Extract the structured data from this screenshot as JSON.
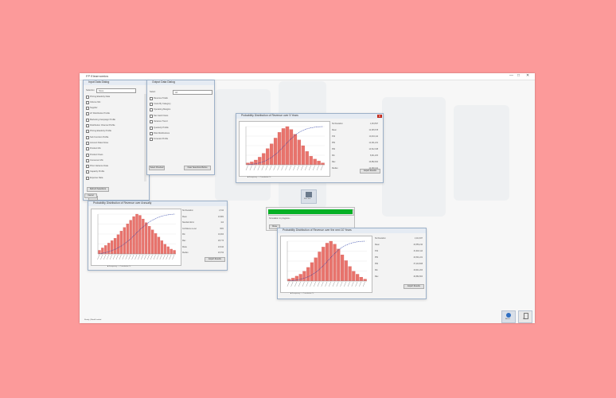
{
  "app": {
    "title": "FP Elearnomics",
    "controls": [
      "—",
      "□",
      "✕"
    ]
  },
  "left_window": {
    "title": "Input Data Dialog",
    "filter_label": "Selection",
    "filter_value": "None",
    "items": [
      "Pricing Elasticity Data",
      "Volume Mix",
      "Supplier",
      "LP Distribution Profile",
      "Marketing Campaign Profile",
      "Distribution Channel Profile",
      "Pricing Elasticity Profile",
      "Sub Function Profile",
      "Account Data Flows",
      "Product Mix",
      "Product Flows",
      "Consumer Mix",
      "Price Variance Data",
      "Capacity Profile",
      "Expense Data"
    ],
    "button_refresh": "Refresh Selections",
    "button_ok": "OK",
    "button_cancel": "Cancel"
  },
  "mid_window": {
    "title": "Output Data Dialog",
    "label": "Select",
    "select_value": "All",
    "items": [
      "Revenue Totals",
      "Costs By Category",
      "Operating Margins",
      "Net Cash Flows",
      "Variance Trend",
      "Quarterly Profile",
      "Risk Distributions",
      "Forecast Profile"
    ],
    "button_select": "Select Checked",
    "button_clear": "Clear Selections Before"
  },
  "charts": [
    {
      "name": "chart-revenue-5-years",
      "title": "Probability Distribution of Revenue over 5 Years",
      "stats_labels": [
        "Std Deviation",
        "Mean",
        "P10",
        "P50",
        "P90",
        "Min",
        "Max",
        "Median"
      ],
      "stats_values": [
        "1,234,567",
        "12,345,678",
        "10,234,112",
        "12,301,221",
        "14,512,338",
        "8,011,203",
        "16,882,904",
        "12,300,441"
      ],
      "legend": "■ Frequency   — Cumulative %",
      "button": "Export Results"
    },
    {
      "name": "chart-revenue-annual",
      "title": "Probability Distribution of Revenue over Annually",
      "stats_labels": [
        "Std Deviation",
        "Mean",
        "Standard Error",
        "Confidence Level",
        "Min",
        "Max",
        "Mode",
        "Median"
      ],
      "stats_values": [
        "2,312",
        "23,881",
        "112",
        "95%",
        "19,004",
        "28,773",
        "23,610",
        "23,702"
      ],
      "legend": "■ Frequency   — Cumulative %",
      "button": "Export Results"
    },
    {
      "name": "chart-revenue-10-years",
      "title": "Probability Distribution of Revenue over the next 10 Years",
      "stats_labels": [
        "Std Deviation",
        "Mean",
        "P10",
        "P50",
        "P90",
        "Min",
        "Max"
      ],
      "stats_values": [
        "2,114,337",
        "34,556,210",
        "31,902,114",
        "34,501,221",
        "37,204,668",
        "29,011,203",
        "40,882,904"
      ],
      "legend": "■ Frequency   — Cumulative %",
      "button": "Export Results"
    }
  ],
  "chart_data": [
    {
      "type": "bar",
      "values": [
        2,
        3,
        5,
        8,
        12,
        17,
        22,
        28,
        34,
        38,
        40,
        37,
        32,
        26,
        20,
        14,
        9,
        6,
        4,
        2
      ],
      "cumulative": true
    },
    {
      "type": "bar",
      "values": [
        3,
        5,
        7,
        9,
        11,
        13,
        16,
        19,
        22,
        25,
        28,
        31,
        33,
        32,
        29,
        26,
        23,
        20,
        17,
        14,
        11,
        8,
        6,
        4,
        3
      ],
      "cumulative": true
    },
    {
      "type": "bar",
      "values": [
        2,
        3,
        5,
        7,
        10,
        14,
        19,
        24,
        30,
        35,
        39,
        41,
        38,
        33,
        27,
        21,
        15,
        10,
        7,
        4,
        2
      ],
      "cumulative": true
    }
  ],
  "progress": {
    "message": "Simulation in progress...",
    "value": 100,
    "button": "Close"
  },
  "run_button": {
    "label": "Run Sim"
  },
  "bottom_buttons": [
    {
      "label": "About"
    },
    {
      "label": "Exit"
    }
  ],
  "status": "Ready  |  Model loaded"
}
